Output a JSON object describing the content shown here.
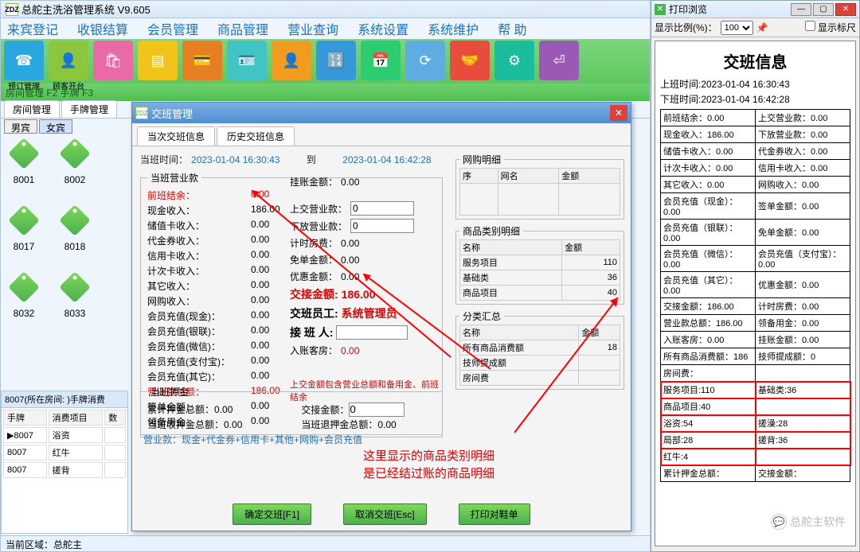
{
  "app_title": "总舵主洗浴管理系统  V9.605",
  "menu": [
    "来宾登记",
    "收银结算",
    "会员管理",
    "商品管理",
    "营业查询",
    "系统设置",
    "系统维护",
    "帮  助"
  ],
  "toolbar_labels": [
    "预订管理",
    "顾客开台"
  ],
  "subbar": "房间管理 F2  手牌 F3",
  "left_tabs": [
    "房间管理",
    "手牌管理"
  ],
  "gender_tabs": [
    "男宾",
    "女宾"
  ],
  "tags": [
    "8001",
    "8002",
    "",
    "8017",
    "8018",
    "",
    "8032",
    "8033",
    ""
  ],
  "bottom_panel_title": "8007(所在房间: )手牌消费",
  "bottom_cols": [
    "手牌",
    "消费项目",
    "数"
  ],
  "bottom_rows": [
    [
      "8007",
      "浴资",
      ""
    ],
    [
      "8007",
      "红牛",
      ""
    ],
    [
      "8007",
      "搓背",
      ""
    ]
  ],
  "status_bar": "当前区域：总舵主",
  "dialog": {
    "title": "交班管理",
    "tabs": [
      "当次交班信息",
      "历史交班信息"
    ],
    "shift_start_label": "当班时间：",
    "shift_start_value": "2023-01-04 16:30:43",
    "to_label": "到",
    "shift_end_value": "2023-01-04 16:42:28",
    "biz_group_title": "当班营业款",
    "biz_left": [
      {
        "k": "前班结余：",
        "v": "0.00",
        "red": true
      },
      {
        "k": "现金收入：",
        "v": "186.00"
      },
      {
        "k": "储值卡收入：",
        "v": "0.00"
      },
      {
        "k": "代金券收入：",
        "v": "0.00"
      },
      {
        "k": "信用卡收入：",
        "v": "0.00"
      },
      {
        "k": "计次卡收入：",
        "v": "0.00"
      },
      {
        "k": "其它收入：",
        "v": "0.00"
      },
      {
        "k": "网购收入：",
        "v": "0.00"
      },
      {
        "k": "会员充值(现金)：",
        "v": "0.00"
      },
      {
        "k": "会员充值(银联)：",
        "v": "0.00"
      },
      {
        "k": "会员充值(微信)：",
        "v": "0.00"
      },
      {
        "k": "会员充值(支付宝)：",
        "v": "0.00"
      },
      {
        "k": "会员充值(其它)：",
        "v": "0.00"
      },
      {
        "k": "营业款总额：",
        "v": "186.00",
        "red": true
      },
      {
        "k": "签单金额：",
        "v": "0.00"
      },
      {
        "k": "领备用金：",
        "v": "0.00"
      }
    ],
    "mid": {
      "gz_label": "挂账金额：",
      "gz_val": "0.00",
      "sj_label": "上交营业款：",
      "sj_val": "0",
      "xf_label": "下放营业款：",
      "xf_val": "0",
      "js_label": "计时房费：",
      "js_val": "0.00",
      "md_label": "免单金额：",
      "md_val": "0.00",
      "yh_label": "优惠金额：",
      "yh_val": "0.00",
      "jj_label": "交接金额:",
      "jj_val": "186.00",
      "yg_label": "交班员工:",
      "yg_val": "系统管理员",
      "jb_label": "接 班 人:",
      "rz_label": "入账客房：",
      "rz_val": "0.00"
    },
    "note_red": "上交金额包含营业总额和备用金、前班结余",
    "deposit_title": "当班押金",
    "deposit_left": [
      {
        "k": "累计押金总额：",
        "v": "0.00"
      },
      {
        "k": "当班收押金总额：",
        "v": "0.00"
      }
    ],
    "deposit_mid": {
      "l1": "交接金额：",
      "v1": "0",
      "l2": "当班退押金总额：",
      "v2": "0.00"
    },
    "formula": "营业款：现金+代金券+信用卡+其他+网购+会员充值",
    "right": {
      "wg_title": "网购明细",
      "wg_cols": [
        "序",
        "网名",
        "金额"
      ],
      "lb_title": "商品类别明细",
      "lb_cols": [
        "名称",
        "金额"
      ],
      "lb_rows": [
        [
          "服务项目",
          "110"
        ],
        [
          "基础类",
          "36"
        ],
        [
          "商品项目",
          "40"
        ]
      ],
      "fl_title": "分类汇总",
      "fl_cols": [
        "名称",
        "金额"
      ],
      "fl_rows": [
        [
          "所有商品消费额",
          "18"
        ],
        [
          "技师提成额",
          ""
        ],
        [
          "房间费",
          ""
        ]
      ]
    },
    "buttons": [
      "确定交班[F1]",
      "取消交班[Esc]",
      "打印对鞋单"
    ],
    "anno1": "这里显示的商品类别明细",
    "anno2": "是已经结过账的商品明细"
  },
  "preview": {
    "win_title": "打印浏览",
    "scale_label": "显示比例(%)：",
    "scale_val": "100",
    "show_ruler": "显示标尺",
    "heading": "交班信息",
    "t1": "上班时间:2023-01-04 16:30:43",
    "t2": "下班时间:2023-01-04 16:42:28",
    "cells": [
      [
        "前班结余：0.00",
        "上交营业款：0.00"
      ],
      [
        "现金收入：186.00",
        "下放营业款：0.00"
      ],
      [
        "储值卡收入：0.00",
        "代金券收入：0.00"
      ],
      [
        "计次卡收入：0.00",
        "信用卡收入：0.00"
      ],
      [
        "其它收入：0.00",
        "网购收入：0.00"
      ],
      [
        "会员充值（现金）：0.00",
        "签单金额：0.00"
      ],
      [
        "会员充值（银联）：0.00",
        "免单金额：0.00"
      ],
      [
        "会员充值（微信）：0.00",
        "会员充值（支付宝）：0.00"
      ],
      [
        "会员充值（其它）：0.00",
        "优惠金额：0.00"
      ],
      [
        "交接金额：186.00",
        "计时房费：0.00"
      ],
      [
        "营业款总额：186.00",
        "领备用金：0.00"
      ],
      [
        "入账客房：0.00",
        "挂账金额：0.00"
      ],
      [
        "所有商品消费额：186",
        "技师提成额：0"
      ],
      [
        "房间费：",
        ""
      ],
      [
        "服务项目:110",
        "基础类:36"
      ],
      [
        "商品项目:40",
        ""
      ],
      [
        "浴资:54",
        "搓澡:28"
      ],
      [
        "局部:28",
        "搓背:36"
      ],
      [
        "红牛:4",
        ""
      ],
      [
        "累计押金总额：",
        "交接金额："
      ]
    ],
    "redbox_rows": [
      14,
      15,
      16,
      17,
      18
    ]
  },
  "watermark": "总舵主软件",
  "chart_data": {
    "type": "table",
    "title": "商品类别明细",
    "columns": [
      "名称",
      "金额"
    ],
    "rows": [
      [
        "服务项目",
        110
      ],
      [
        "基础类",
        36
      ],
      [
        "商品项目",
        40
      ]
    ]
  }
}
